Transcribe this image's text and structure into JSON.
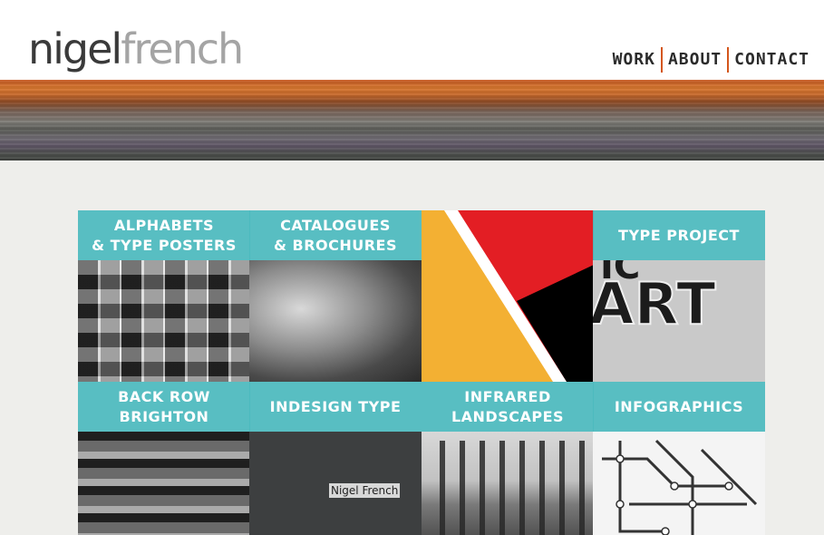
{
  "header": {
    "logo_part1": "nigel",
    "logo_part2": "french",
    "nav": [
      "WORK",
      "ABOUT",
      "CONTACT"
    ]
  },
  "tiles": [
    {
      "label": "ALPHABETS\n& TYPE POSTERS"
    },
    {
      "label": "CATALOGUES\n& BROCHURES"
    },
    {
      "label": ""
    },
    {
      "label": "TYPE PROJECT"
    },
    {
      "label": "BACK ROW BRIGHTON"
    },
    {
      "label": "INDESIGN TYPE"
    },
    {
      "label": "INFRARED LANDSCAPES"
    },
    {
      "label": "INFOGRAPHICS"
    }
  ],
  "indesign_photo_text": "Nigel French",
  "colors": {
    "accent": "#d4561c",
    "teal": "#4bbabe",
    "yellow": "#f3b033",
    "red": "#e31e24",
    "black": "#000000"
  },
  "icons": [
    "geometric-artwork-icon"
  ]
}
